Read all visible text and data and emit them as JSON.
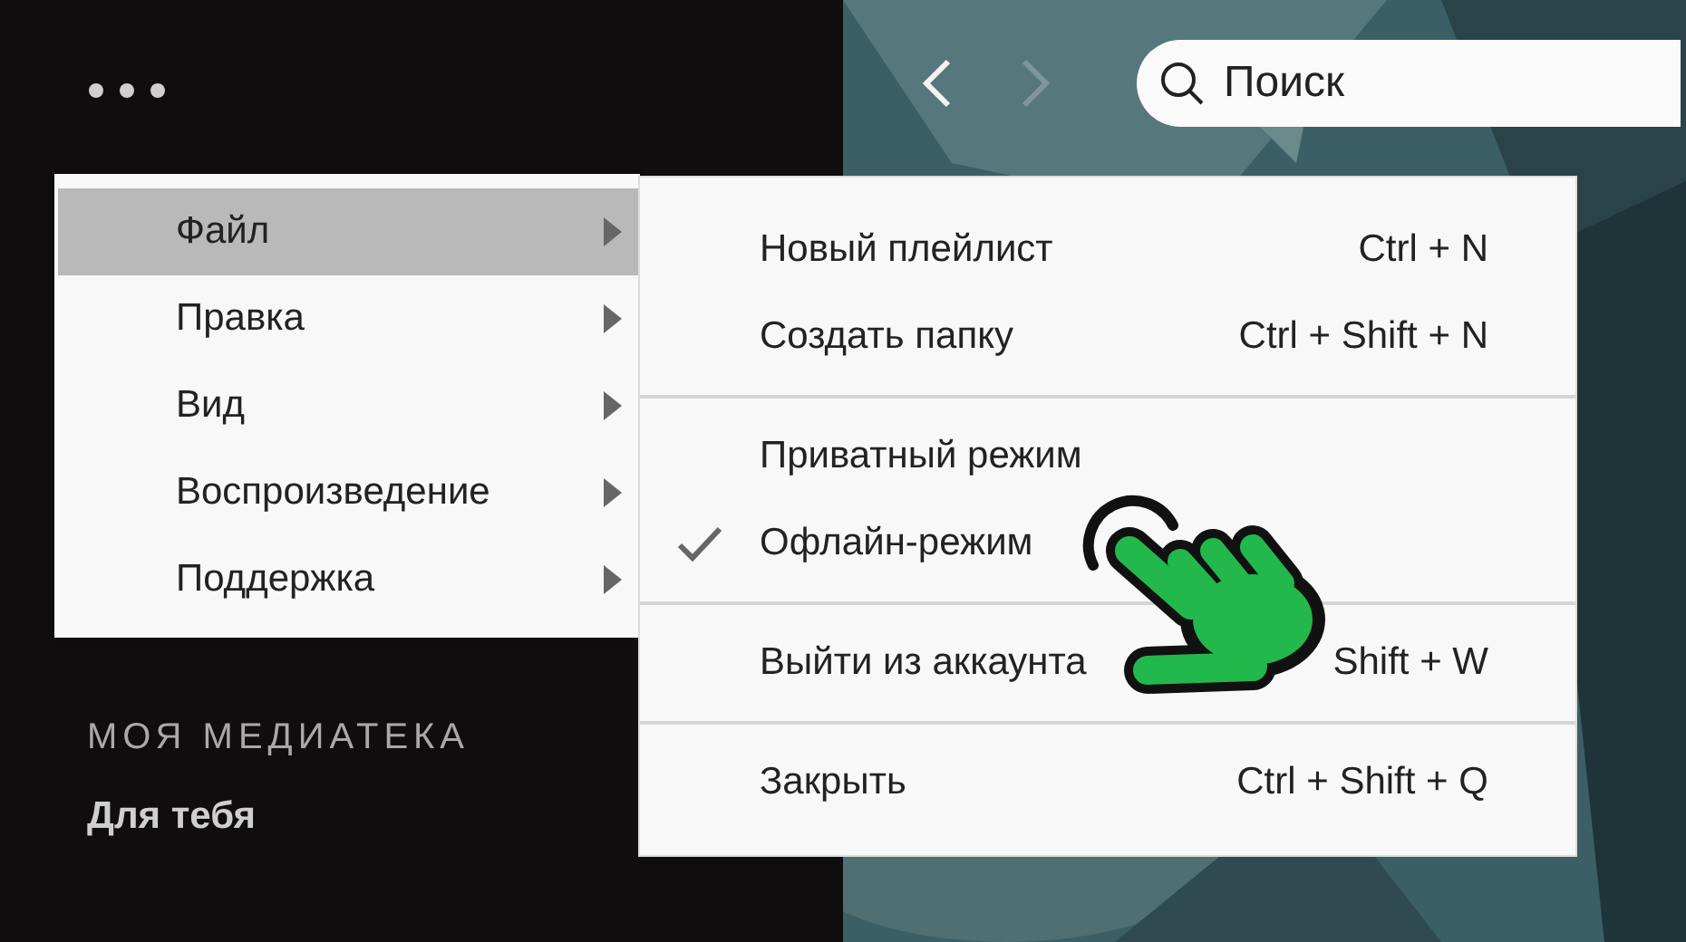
{
  "sidebar": {
    "section_title": "МОЯ МЕДИАТЕКА",
    "items": [
      {
        "label": "Для тебя"
      }
    ]
  },
  "search": {
    "placeholder": "Поиск"
  },
  "menu": {
    "items": [
      {
        "label": "Файл",
        "selected": true
      },
      {
        "label": "Правка",
        "selected": false
      },
      {
        "label": "Вид",
        "selected": false
      },
      {
        "label": "Воспроизведение",
        "selected": false
      },
      {
        "label": "Поддержка",
        "selected": false
      }
    ]
  },
  "submenu": {
    "groups": [
      {
        "items": [
          {
            "label": "Новый плейлист",
            "shortcut": "Ctrl + N",
            "checked": false
          },
          {
            "label": "Создать папку",
            "shortcut": "Ctrl + Shift + N",
            "checked": false
          }
        ]
      },
      {
        "items": [
          {
            "label": "Приватный режим",
            "checked": false
          },
          {
            "label": "Офлайн-режим",
            "checked": true
          }
        ]
      },
      {
        "items": [
          {
            "label": "Выйти из аккаунта",
            "shortcut": "Shift + W",
            "checked": false
          }
        ]
      },
      {
        "items": [
          {
            "label": "Закрыть",
            "shortcut": "Ctrl + Shift + Q",
            "checked": false
          }
        ]
      }
    ]
  }
}
